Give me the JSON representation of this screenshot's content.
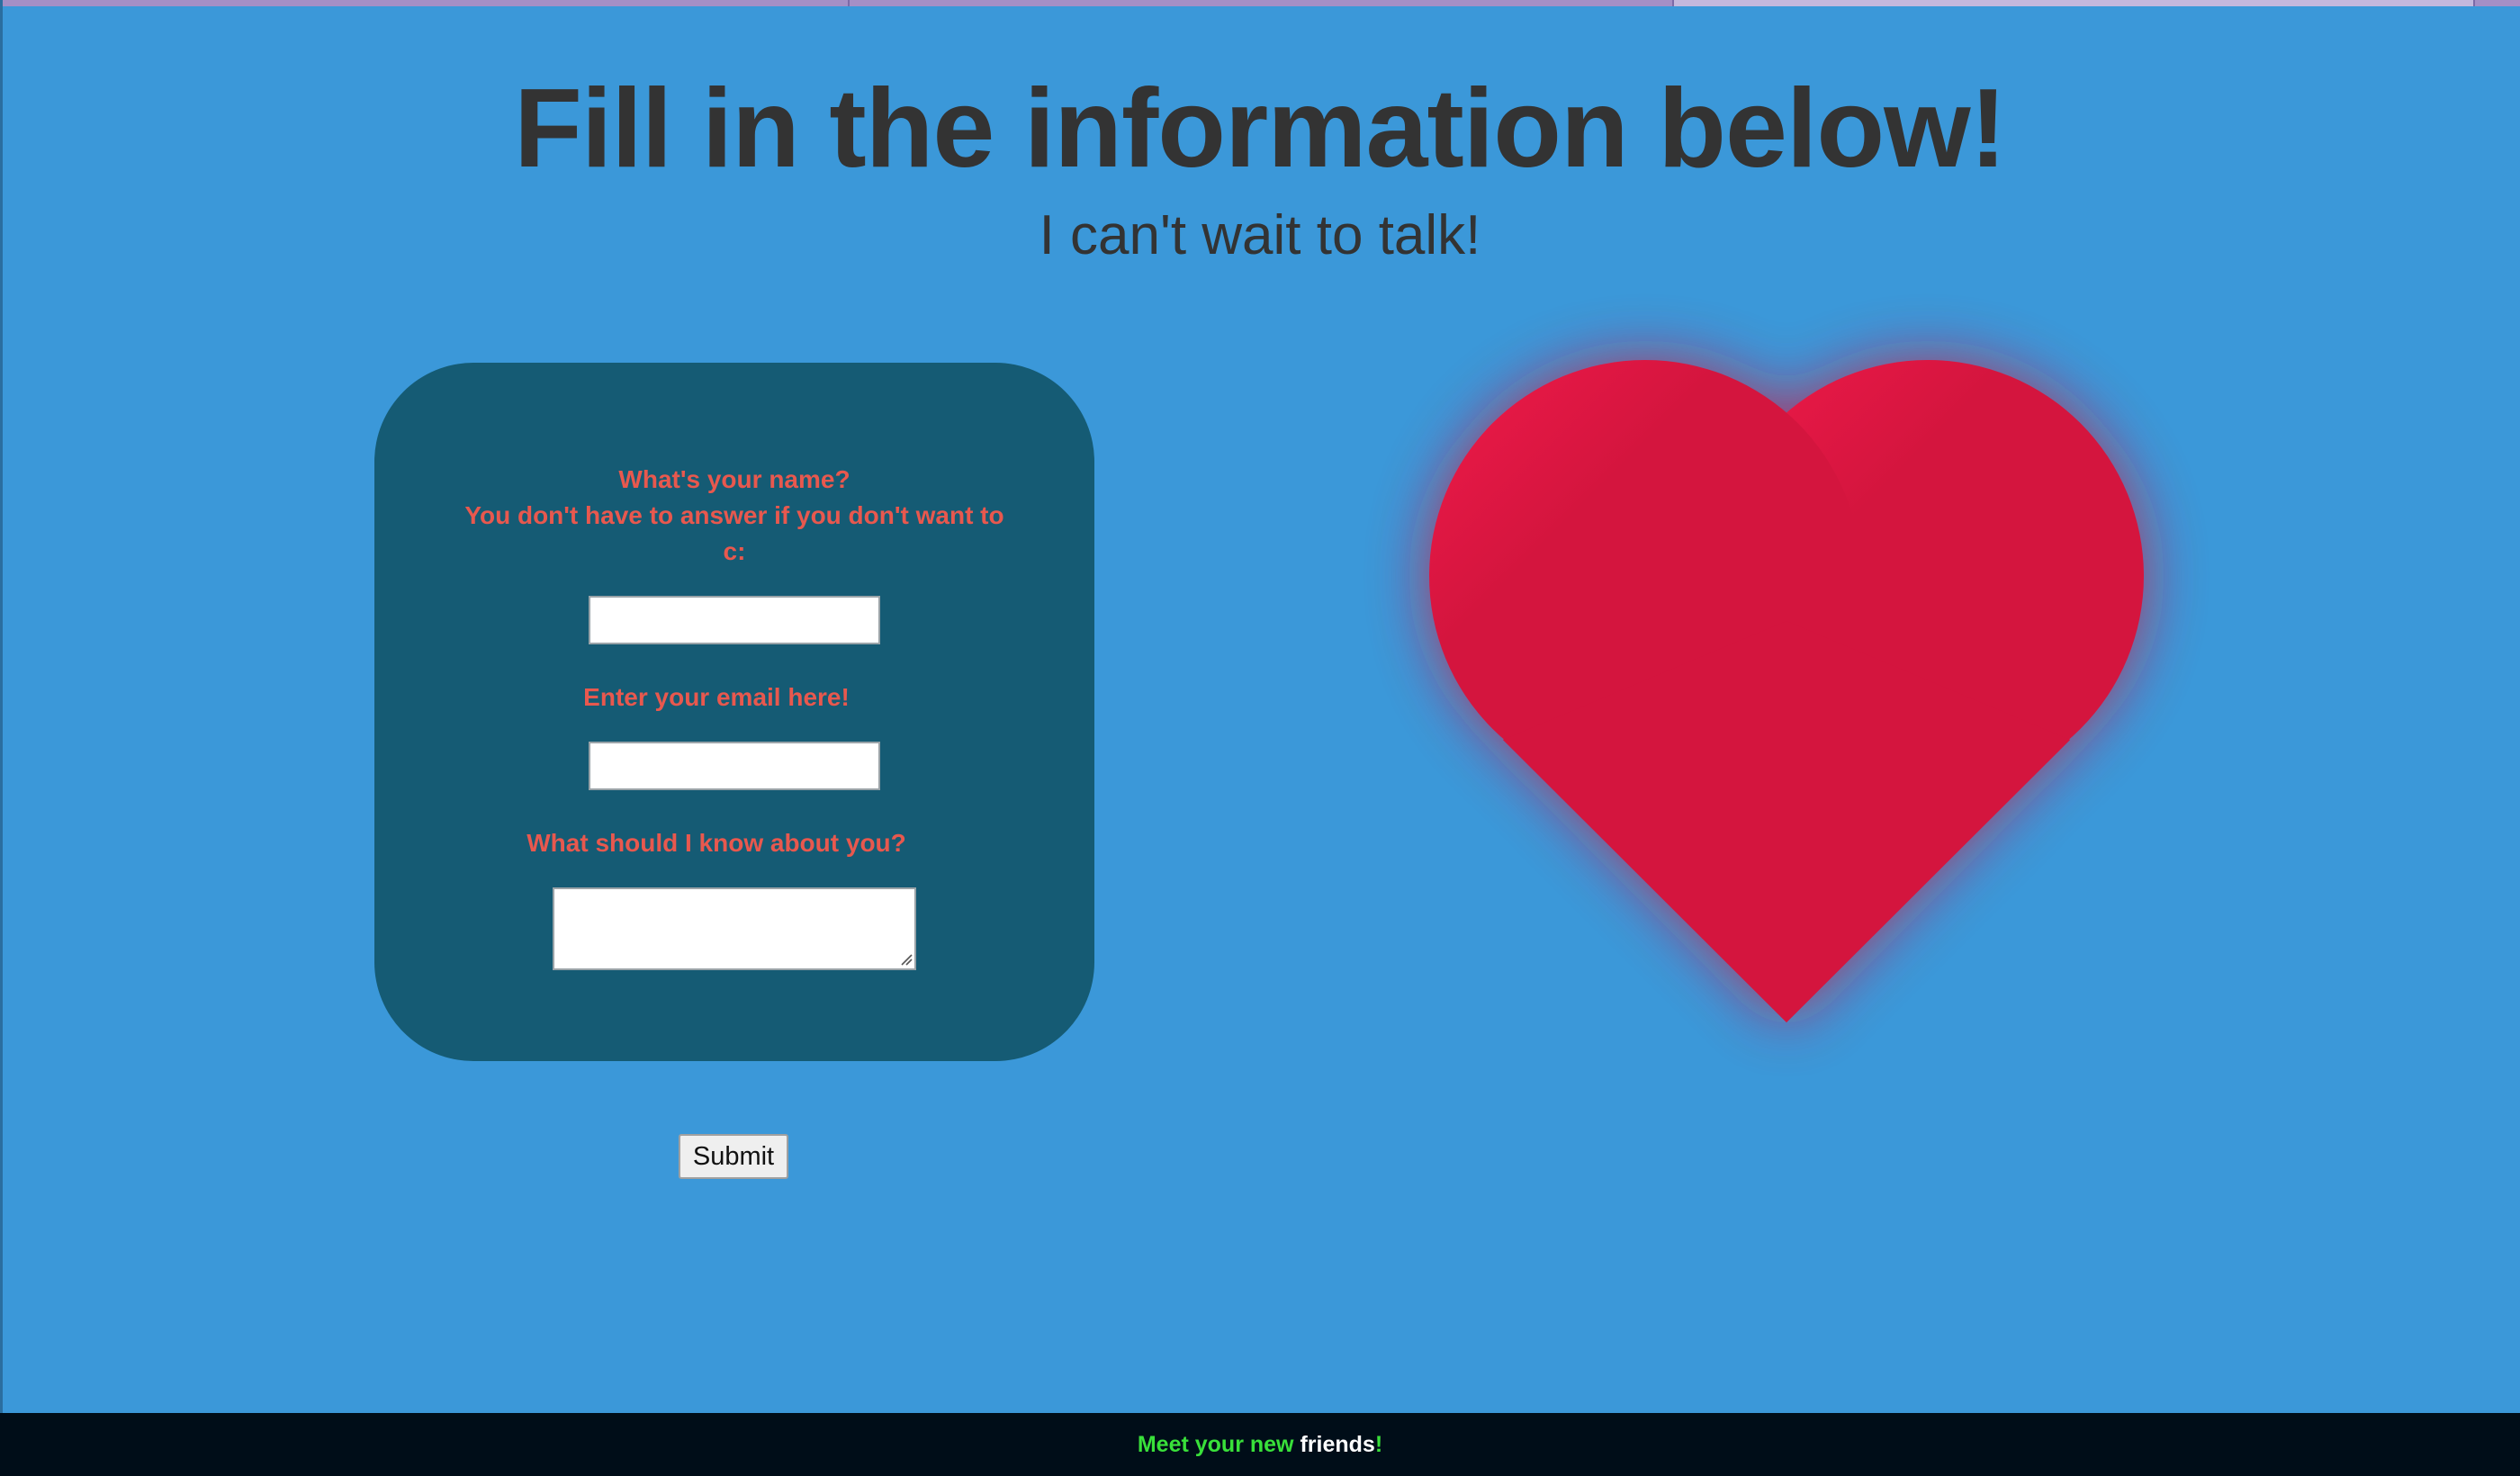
{
  "page": {
    "title": "Fill in the information below!",
    "subtitle": "I can't wait to talk!"
  },
  "form": {
    "name_question_line1": "What's your name?",
    "name_question_line2": "You don't have to answer if you don't want to c:",
    "name_value": "",
    "email_question": "Enter your email here!",
    "email_value": "",
    "about_question": "What should I know about you?",
    "about_value": "",
    "submit_label": "Submit"
  },
  "footer": {
    "part1": "Meet your new",
    "part2": "friends",
    "part3": "!"
  },
  "colors": {
    "background": "#3b98d9",
    "card": "#155b74",
    "question_text": "#e8584e",
    "heart": "#d4153e",
    "footer_bg": "#000d18",
    "footer_green": "#39e03a"
  },
  "icons": {
    "heart": "heart-icon",
    "resize_grip": "resize-grip-icon"
  }
}
